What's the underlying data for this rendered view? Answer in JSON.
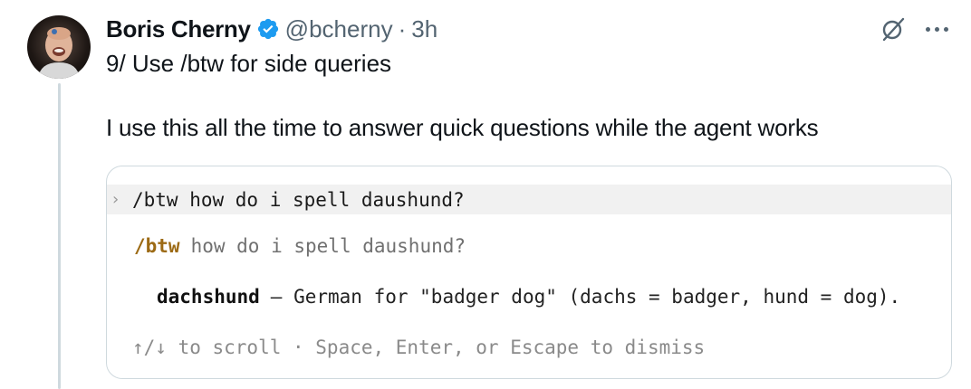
{
  "post": {
    "author_name": "Boris Cherny",
    "handle": "@bcherny",
    "separator": "·",
    "time": "3h",
    "verified_icon": "verified-badge-icon",
    "verified_color": "#1d9bf0",
    "avatar_icon": "user-avatar",
    "grok_icon": "grok-icon",
    "more_icon": "more-options-icon",
    "text_line1": "9/ Use /btw for side queries",
    "text_line2": "I use this all the time to answer quick questions while the agent works"
  },
  "terminal": {
    "prompt_caret": "›",
    "prompt_text": "/btw how do i spell daushund?",
    "btw_command": "/btw",
    "btw_query": "how do i spell daushund?",
    "answer_word": "dachshund",
    "answer_rest": "— German for \"badger dog\" (dachs = badger, hund = dog).",
    "hint": "↑/↓ to scroll · Space, Enter, or Escape to dismiss",
    "command_color": "#9c6a14"
  }
}
